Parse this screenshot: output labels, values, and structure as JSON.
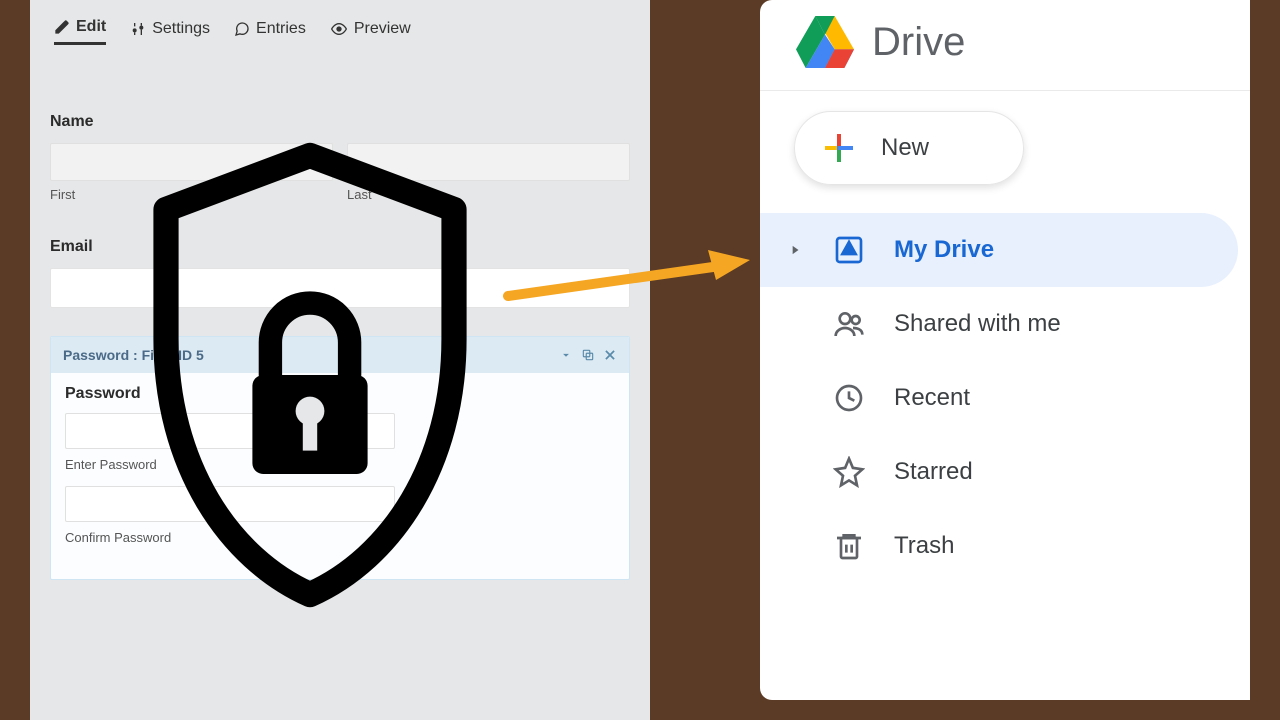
{
  "form": {
    "tabs": {
      "edit": "Edit",
      "settings": "Settings",
      "entries": "Entries",
      "preview": "Preview"
    },
    "name_label": "Name",
    "first_label": "First",
    "last_label": "Last",
    "email_label": "Email",
    "password_block_title": "Password : Field ID 5",
    "password_label": "Password",
    "enter_password": "Enter Password",
    "confirm_password": "Confirm Password"
  },
  "drive": {
    "title": "Drive",
    "new_label": "New",
    "nav": {
      "my_drive": "My Drive",
      "shared": "Shared with me",
      "recent": "Recent",
      "starred": "Starred",
      "trash": "Trash"
    }
  }
}
